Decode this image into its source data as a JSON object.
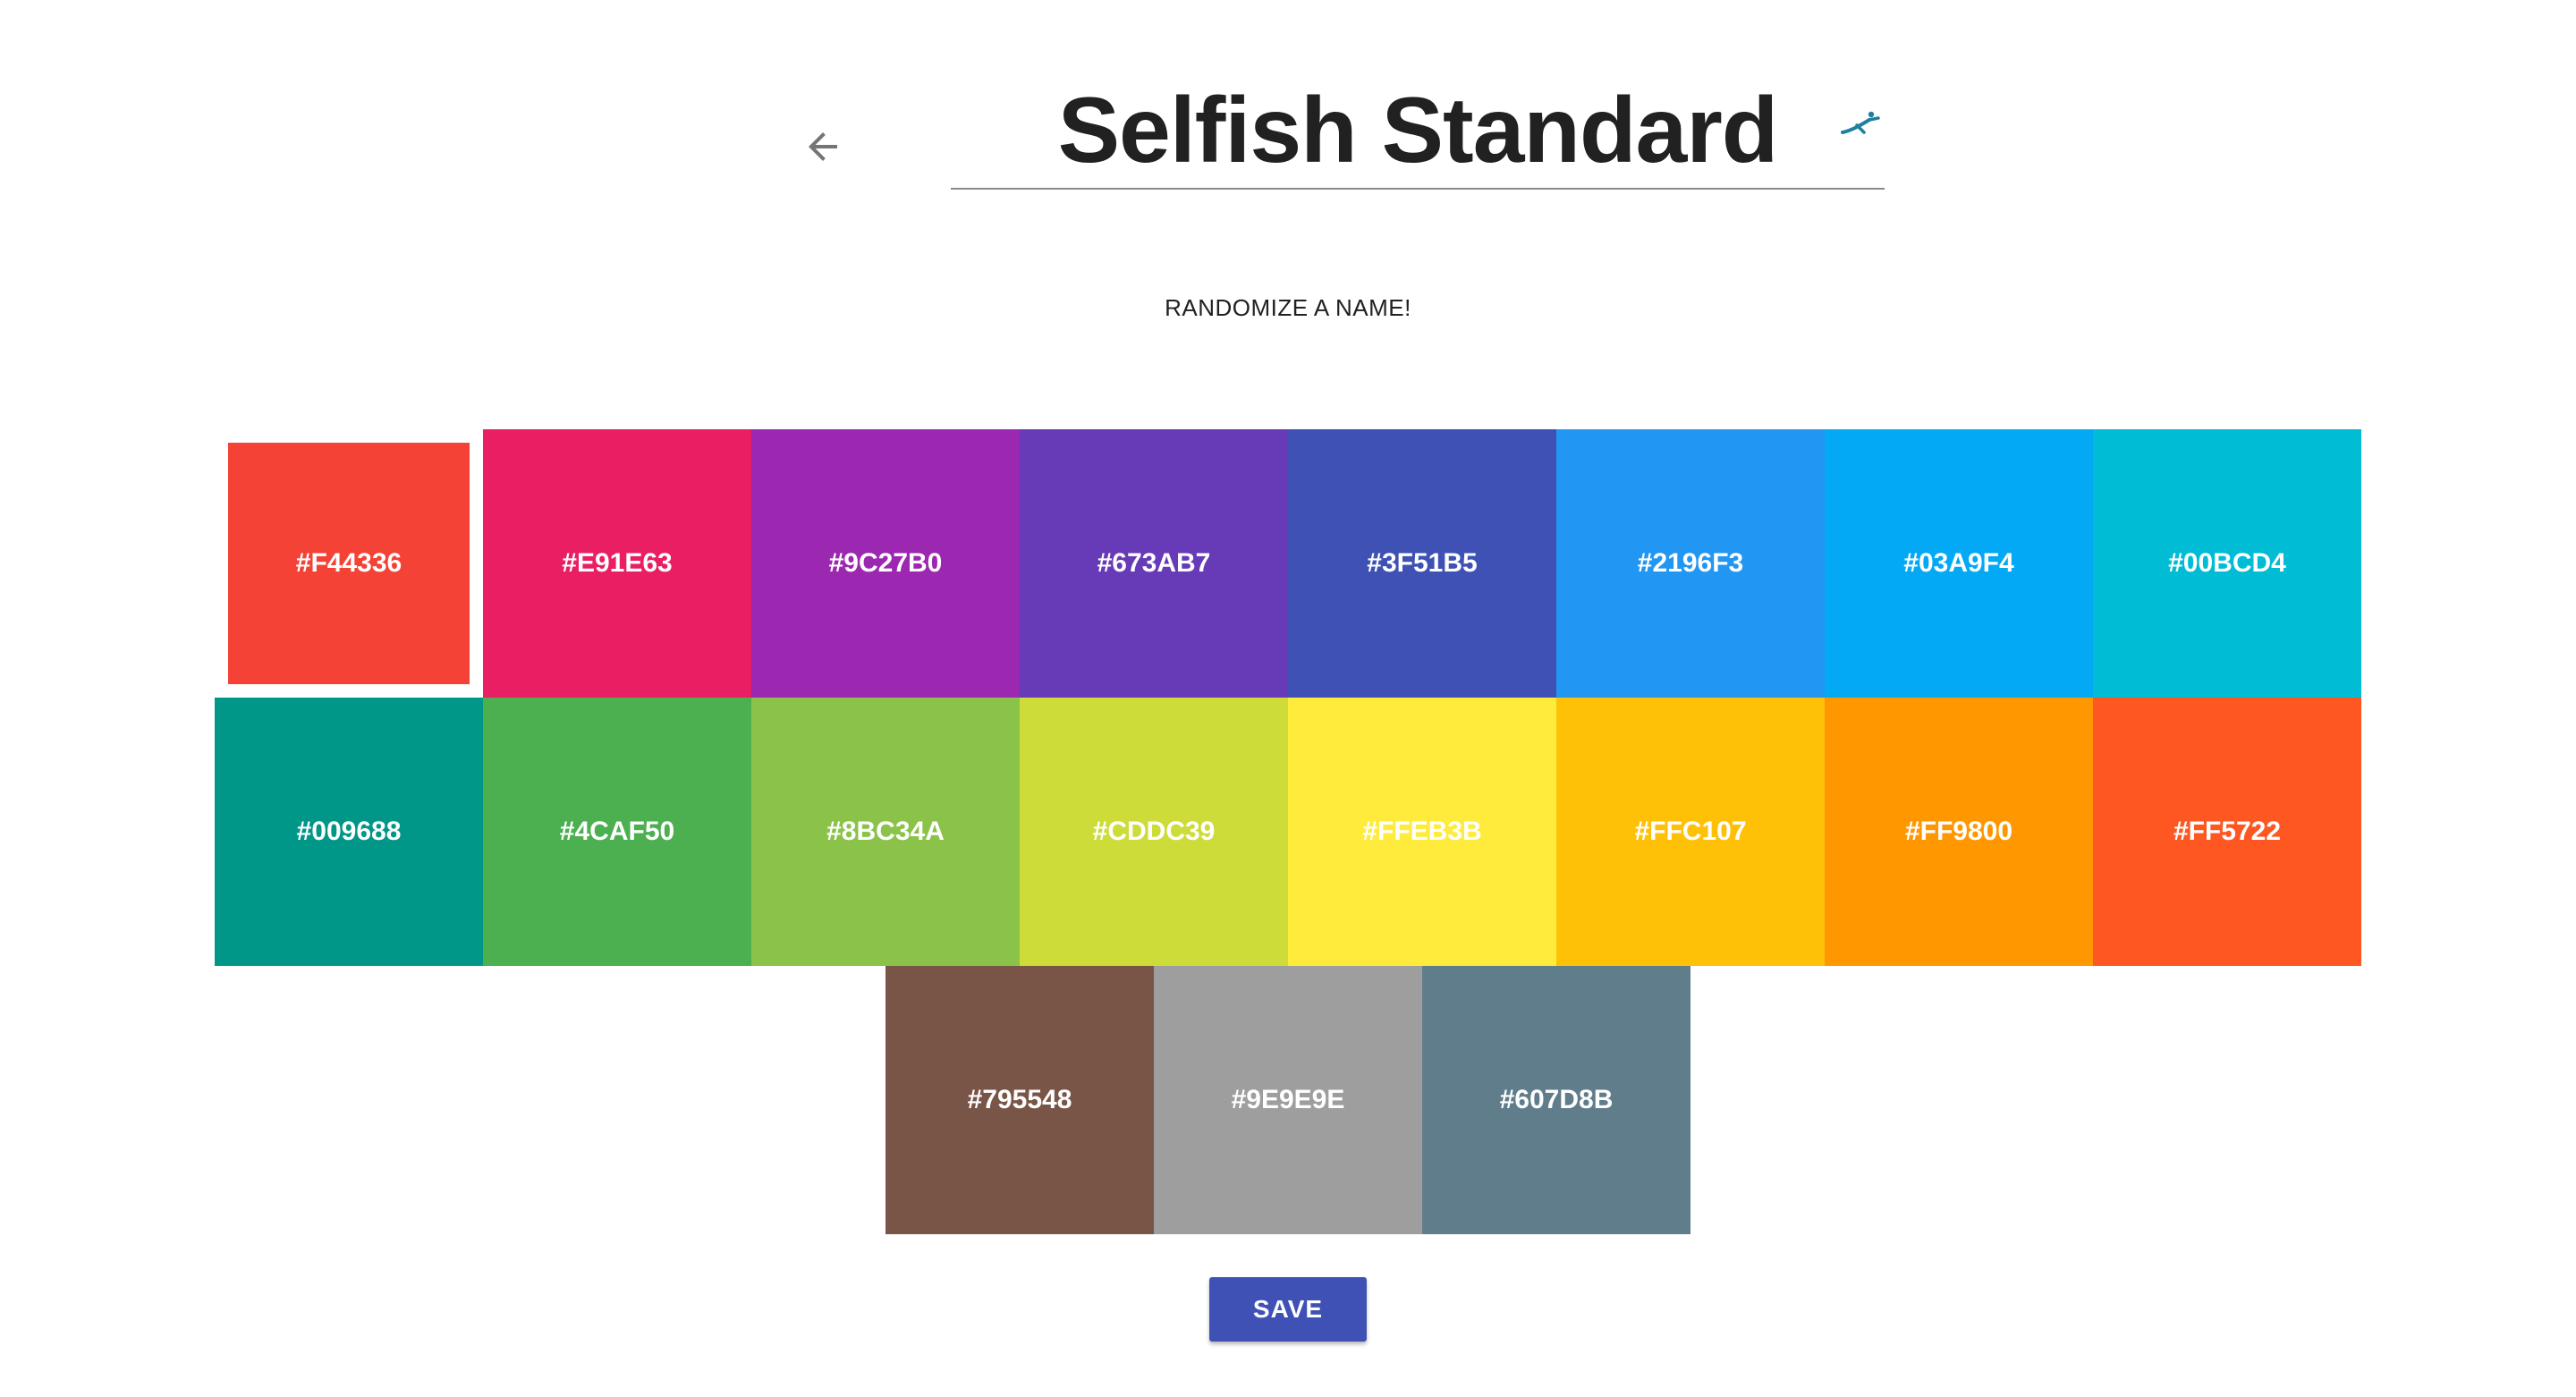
{
  "header": {
    "back_icon": "arrow-left-icon",
    "name_value": "Selfish Standard",
    "name_icon": "swimmer-icon",
    "randomize_label": "RANDOMIZE A NAME!"
  },
  "palette": {
    "selected": "#F44336",
    "swatches": [
      {
        "label": "#F44336",
        "color": "#F44336"
      },
      {
        "label": "#E91E63",
        "color": "#E91E63"
      },
      {
        "label": "#9C27B0",
        "color": "#9C27B0"
      },
      {
        "label": "#673AB7",
        "color": "#673AB7"
      },
      {
        "label": "#3F51B5",
        "color": "#3F51B5"
      },
      {
        "label": "#2196F3",
        "color": "#2196F3"
      },
      {
        "label": "#03A9F4",
        "color": "#03A9F4"
      },
      {
        "label": "#00BCD4",
        "color": "#00BCD4"
      },
      {
        "label": "#009688",
        "color": "#009688"
      },
      {
        "label": "#4CAF50",
        "color": "#4CAF50"
      },
      {
        "label": "#8BC34A",
        "color": "#8BC34A"
      },
      {
        "label": "#CDDC39",
        "color": "#CDDC39"
      },
      {
        "label": "#FFEB3B",
        "color": "#FFEB3B"
      },
      {
        "label": "#FFC107",
        "color": "#FFC107"
      },
      {
        "label": "#FF9800",
        "color": "#FF9800"
      },
      {
        "label": "#FF5722",
        "color": "#FF5722"
      },
      {
        "label": "#795548",
        "color": "#795548"
      },
      {
        "label": "#9E9E9E",
        "color": "#9E9E9E"
      },
      {
        "label": "#607D8B",
        "color": "#607D8B"
      }
    ]
  },
  "actions": {
    "save_label": "SAVE",
    "save_color": "#3F51B5"
  }
}
